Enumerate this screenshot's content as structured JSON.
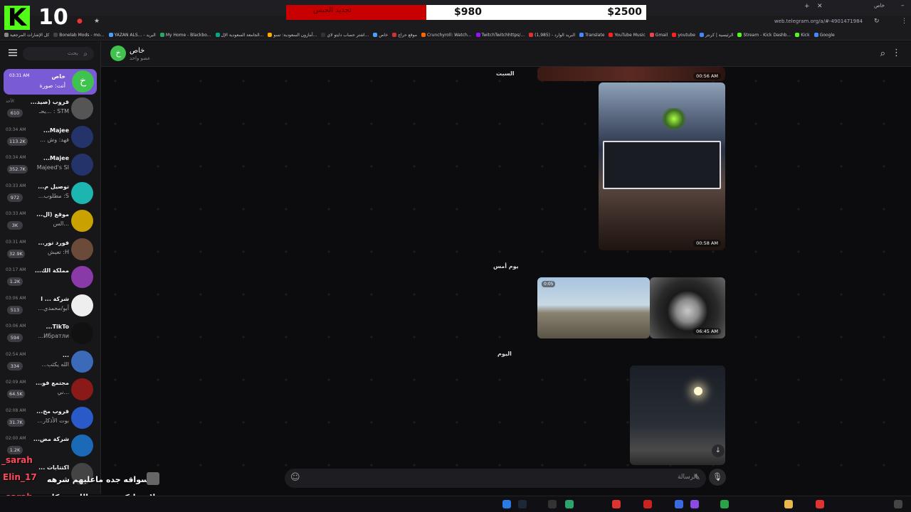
{
  "stream": {
    "logo_letter": "K",
    "counter": "10",
    "goal": {
      "label": "تجديد الجبس",
      "current": "$980",
      "target": "$2500",
      "progress": 0.39,
      "fill_color": "#c90000"
    }
  },
  "browser": {
    "url": "web.telegram.org/a/#-4901471984",
    "profile": "خاص",
    "bookmarks": [
      {
        "label": "كل الإشارات المرجعية",
        "color": "#888"
      },
      {
        "label": "Bonelab Mods - mo...",
        "color": "#444"
      },
      {
        "label": "YAZAN ALS... - البريد",
        "color": "#4aa0ff"
      },
      {
        "label": "My Home - Blackbo...",
        "color": "#2a6"
      },
      {
        "label": "الجامعة السعودية الإل...",
        "color": "#0a8"
      },
      {
        "label": "أمازون السعودية: تسو...",
        "color": "#fa0"
      },
      {
        "label": "اشتر حساب دايتو لاي...",
        "color": "#333"
      },
      {
        "label": "خاص",
        "color": "#4aa0ff"
      },
      {
        "label": "موقع حراج",
        "color": "#c33"
      },
      {
        "label": "Crunchyroll: Watch...",
        "color": "#f60"
      },
      {
        "label": "TwitchTwitchhttps/...",
        "color": "#91f"
      },
      {
        "label": "(1,985) - البريد الوارد",
        "color": "#d33"
      },
      {
        "label": "Translate",
        "color": "#48f"
      },
      {
        "label": "YouTube Music",
        "color": "#f22"
      },
      {
        "label": "Gmail",
        "color": "#e44"
      },
      {
        "label": "youtube",
        "color": "#f22"
      },
      {
        "label": "الرئيسية | كرنتر",
        "color": "#48f"
      },
      {
        "label": "Stream - Kick Dashb...",
        "color": "#53fc18"
      },
      {
        "label": "Kick",
        "color": "#53fc18"
      },
      {
        "label": "Google",
        "color": "#48f"
      }
    ]
  },
  "sidebar": {
    "search_placeholder": "بحث",
    "chats": [
      {
        "title": "خاص",
        "time": "03:31 AM",
        "preview": "أنت: صورة",
        "avatar_letter": "خ",
        "avatar_color": "#3fc24e",
        "active": true,
        "badge": ""
      },
      {
        "title": "قروب (صيد...",
        "time": "الأحد",
        "preview": "STM : ...يحـ",
        "avatar_letter": "",
        "avatar_color": "#555",
        "badge": "610"
      },
      {
        "title": "Majee...",
        "time": "03:34 AM",
        "preview": "فهد: وش ...",
        "avatar_letter": "",
        "avatar_color": "#24346a",
        "badge": "113.2K"
      },
      {
        "title": "Majee...",
        "time": "03:34 AM",
        "preview": "Majeed's SI",
        "avatar_letter": "",
        "avatar_color": "#24346a",
        "badge": "352.7K"
      },
      {
        "title": "توصيل م...",
        "time": "03:33 AM",
        "preview": "S: مطلوب...",
        "avatar_letter": "",
        "avatar_color": "#1db5b0",
        "badge": "972"
      },
      {
        "title": "موقع (ال...",
        "time": "03:33 AM",
        "preview": "...الس",
        "avatar_letter": "",
        "avatar_color": "#c9a100",
        "badge": "3K"
      },
      {
        "title": "فورد تور...",
        "time": "03:31 AM",
        "preview": "H: تعيش",
        "avatar_letter": "",
        "avatar_color": "#6b4a3a",
        "badge": "32.9K"
      },
      {
        "title": "مملكة الك...",
        "time": "03:17 AM",
        "preview": "",
        "avatar_letter": "",
        "avatar_color": "#8a3aa8",
        "badge": "1.2K"
      },
      {
        "title": "شركة ... ا",
        "time": "03:06 AM",
        "preview": "أبو/محمدي...",
        "avatar_letter": "",
        "avatar_color": "#eee",
        "badge": "513"
      },
      {
        "title": "TikTo...",
        "time": "03:06 AM",
        "preview": "Ибратли...",
        "avatar_letter": "",
        "avatar_color": "#111",
        "badge": "594"
      },
      {
        "title": "...",
        "time": "02:54 AM",
        "preview": "الله يكثب...",
        "avatar_letter": "",
        "avatar_color": "#3a6ab8",
        "badge": "334"
      },
      {
        "title": "مجتمع فو...",
        "time": "02:09 AM",
        "preview": "...ني",
        "avatar_letter": "",
        "avatar_color": "#8a1a1a",
        "badge": "64.5K"
      },
      {
        "title": "قروب مخ...",
        "time": "02:08 AM",
        "preview": "بوت الأذكار...",
        "avatar_letter": "",
        "avatar_color": "#2a5ac8",
        "badge": "31.7K"
      },
      {
        "title": "شركة مض...",
        "time": "02:00 AM",
        "preview": "",
        "avatar_letter": "",
        "avatar_color": "#1a6ab8",
        "badge": "1.2K"
      },
      {
        "title": "اكتتابات ...",
        "time": "",
        "preview": "",
        "avatar_letter": "",
        "avatar_color": "#444",
        "badge": ""
      }
    ]
  },
  "chat_header": {
    "title": "خاص",
    "subtitle": "عضو واحد",
    "avatar_letter": "خ"
  },
  "messages": {
    "date_1": "السبت",
    "date_2": "يوم أمس",
    "date_3": "اليوم",
    "photo_top_time": "00:56 AM",
    "photo_1_time": "00:58 AM",
    "video_duration": "0:05",
    "video_time": "06:45 AM"
  },
  "composer": {
    "placeholder": "الرسالة"
  },
  "overlay_chat": {
    "user_1": "_sarah",
    "user_2": "Elin_17",
    "msg_1": "سواقه جده ماعليهم شرهه",
    "user_3": "_sarah",
    "msg_2": "سلام عليكم ورحمة الله وبركاته"
  }
}
